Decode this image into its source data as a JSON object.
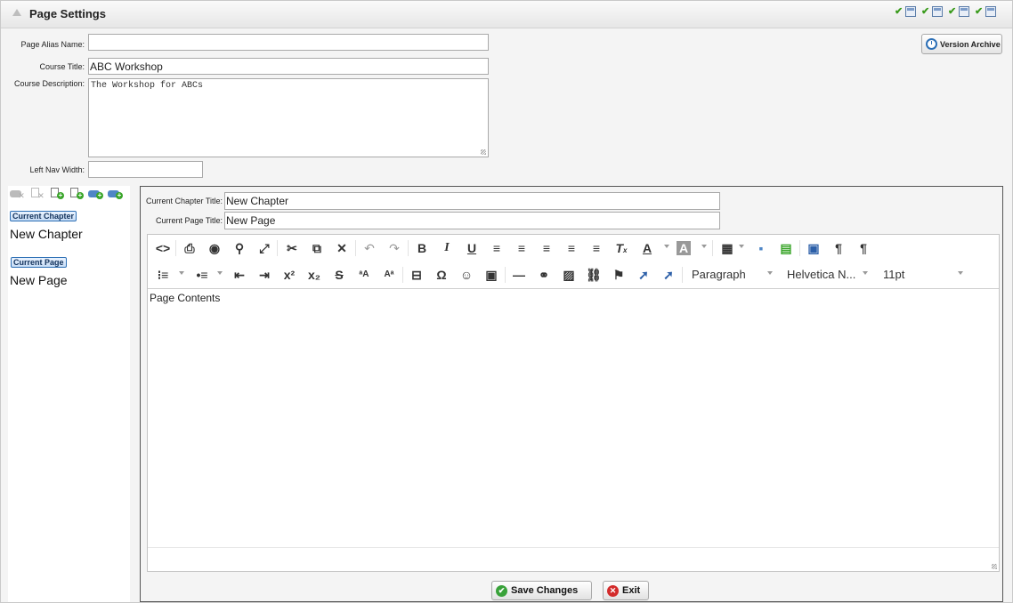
{
  "header": {
    "title": "Page Settings"
  },
  "form": {
    "alias_label": "Page Alias Name:",
    "alias_value": "",
    "course_title_label": "Course Title:",
    "course_title_value": "ABC Workshop",
    "course_desc_label": "Course Description:",
    "course_desc_value": "The Workshop for ABCs",
    "left_nav_width_label": "Left Nav Width:",
    "left_nav_width_value": ""
  },
  "version_archive": {
    "label": "Version Archive"
  },
  "nav": {
    "current_chapter_badge": "Current Chapter",
    "chapter_name": "New Chapter",
    "current_page_badge": "Current Page",
    "page_name": "New Page"
  },
  "editor": {
    "chapter_title_label": "Current Chapter Title:",
    "chapter_title_value": "New Chapter",
    "page_title_label": "Current Page Title:",
    "page_title_value": "New Page",
    "format_select": "Paragraph",
    "font_select": "Helvetica N...",
    "size_select": "11pt",
    "content": "Page Contents"
  },
  "actions": {
    "save_label": "Save Changes",
    "exit_label": "Exit"
  },
  "colors": {
    "accent": "#2d6fb5",
    "save_green": "#39a23a",
    "exit_red": "#d32b2b"
  }
}
